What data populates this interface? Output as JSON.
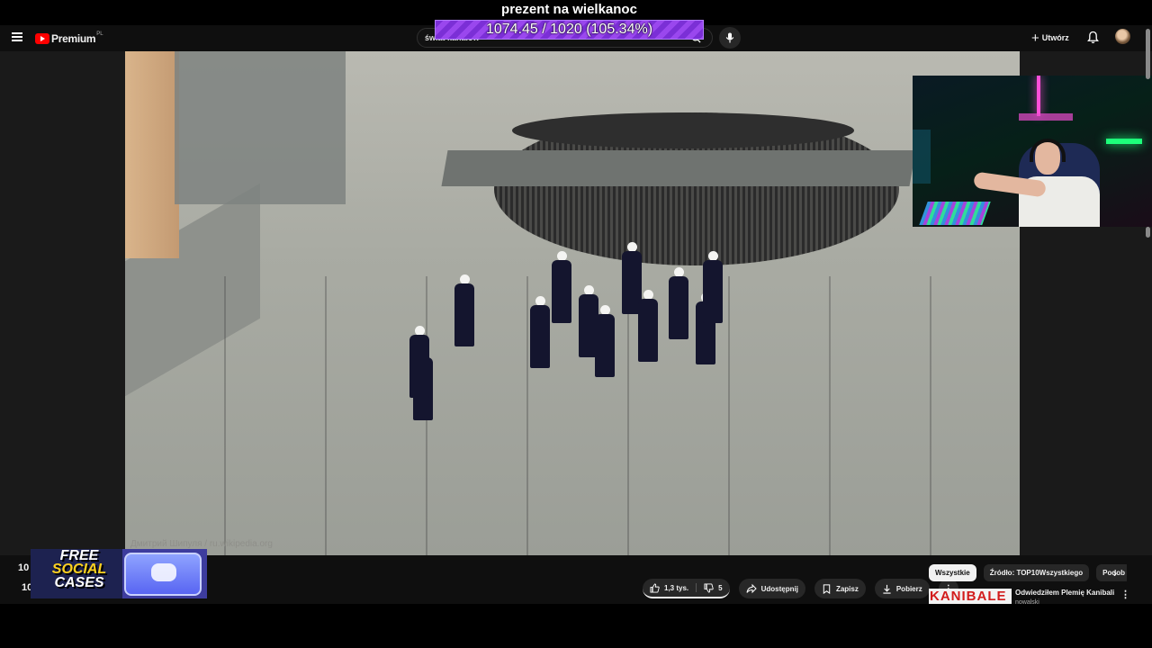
{
  "overlay": {
    "donation_title": "prezent na wielkanoc",
    "goal_text": "1074.45 / 1020 (105.34%)",
    "goal_progress_percent": 105.34
  },
  "header": {
    "brand": "Premium",
    "region": "PL",
    "search_value": "świat kanałów",
    "create_label": "Utwórz",
    "icons": [
      "menu-icon",
      "youtube-logo-icon",
      "search-icon",
      "mic-icon",
      "plus-icon",
      "bell-icon",
      "avatar"
    ]
  },
  "video": {
    "watermark": "Дмитрий Шипуля / ru.wikipedia.org"
  },
  "below": {
    "left_digit_1": "10",
    "left_digit_2": "10",
    "promo": {
      "line1": "FREE",
      "line2": "SOCIAL",
      "line3": "CASES"
    },
    "actions": {
      "like_count": "1,3 tys.",
      "dislike_count": "5",
      "share_label": "Udostępnij",
      "save_label": "Zapisz",
      "download_label": "Pobierz",
      "more_label": "⋮"
    },
    "chips": [
      "Wszystkie",
      "Źródło: TOP10Wszystkiego",
      "Podob"
    ],
    "recommendation": {
      "thumb_text": "KANIBALE",
      "title": "Odwiedziłem Plemię Kanibali",
      "channel": "nowalski"
    }
  },
  "colors": {
    "goal_bar": "#8a3ae4",
    "youtube_red": "#ff0000",
    "background": "#0f0f0f"
  }
}
